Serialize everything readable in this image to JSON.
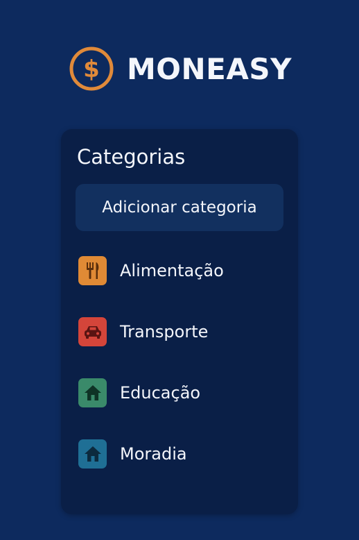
{
  "brand": {
    "name": "MONEASY",
    "icon": "dollar-coin-icon",
    "accent_color": "#e08a3a"
  },
  "panel": {
    "title": "Categorias",
    "add_button_label": "Adicionar categoria"
  },
  "categories": [
    {
      "label": "Alimentação",
      "icon": "fork-knife-icon",
      "color": "#e08a35"
    },
    {
      "label": "Transporte",
      "icon": "car-icon",
      "color": "#d4453a"
    },
    {
      "label": "Educação",
      "icon": "house-icon",
      "color": "#3a8a6a"
    },
    {
      "label": "Moradia",
      "icon": "house-icon",
      "color": "#1f6f95"
    }
  ]
}
